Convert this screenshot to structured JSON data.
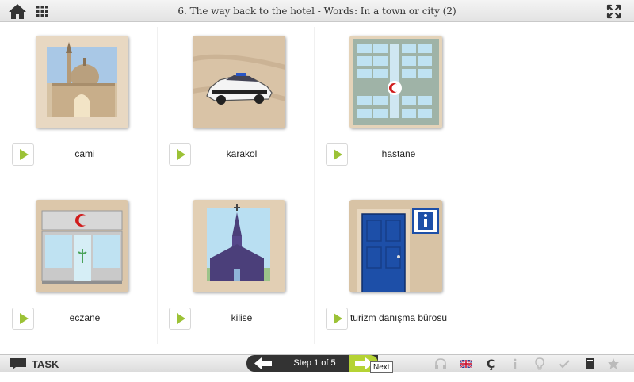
{
  "header": {
    "title": "6. The way back to the hotel - Words: In a town or city (2)"
  },
  "cards": [
    {
      "label": "cami"
    },
    {
      "label": "karakol"
    },
    {
      "label": "hastane"
    },
    {
      "label": "eczane"
    },
    {
      "label": "kilise"
    },
    {
      "label": "turizm danışma bürosu"
    }
  ],
  "footer": {
    "task_label": "TASK",
    "step_text": "Step 1 of 5",
    "next_tooltip": "Next"
  },
  "colors": {
    "accent_green": "#b5d334",
    "play_green": "#9cc236",
    "stepper_dark": "#333333"
  }
}
